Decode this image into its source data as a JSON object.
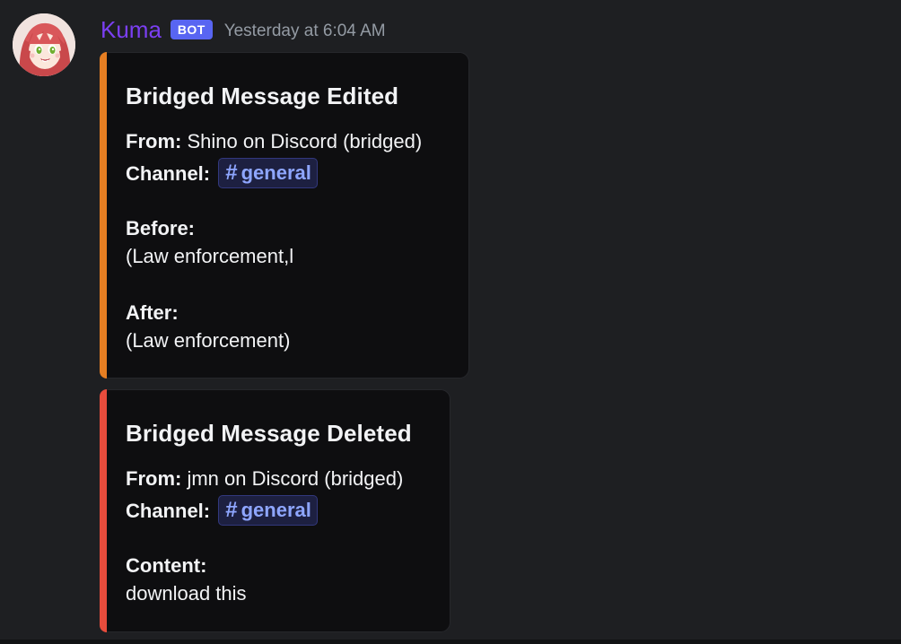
{
  "message": {
    "author": "Kuma",
    "author_color": "#7b3ff2",
    "bot_tag": "BOT",
    "bot_tag_color": "#5865f2",
    "timestamp": "Yesterday at 6:04 AM",
    "avatar_icon": "anime-girl-avatar-icon"
  },
  "embeds": [
    {
      "accent_color": "#e67e22",
      "title": "Bridged Message Edited",
      "from_label": "From:",
      "from_value": "Shino on Discord (bridged)",
      "channel_label": "Channel:",
      "channel_hash": "#",
      "channel_name": "general",
      "before_label": "Before:",
      "before_value": "(Law enforcement,l",
      "after_label": "After:",
      "after_value": "(Law enforcement)"
    },
    {
      "accent_color": "#e74c3c",
      "title": "Bridged Message Deleted",
      "from_label": "From:",
      "from_value": "jmn on Discord (bridged)",
      "channel_label": "Channel:",
      "channel_hash": "#",
      "channel_name": "general",
      "content_label": "Content:",
      "content_value": "download this"
    }
  ]
}
